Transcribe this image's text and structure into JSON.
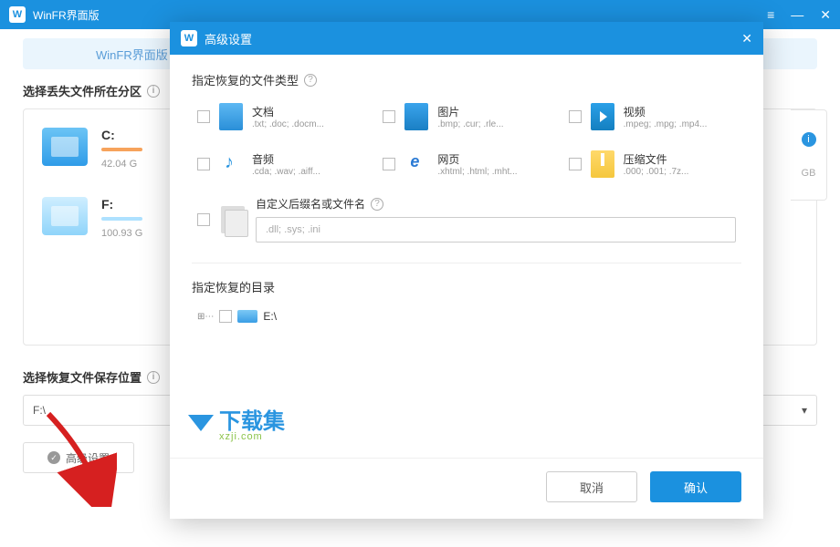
{
  "titlebar": {
    "app_name": "WinFR界面版"
  },
  "banner": {
    "text": "WinFR界面版"
  },
  "labels": {
    "select_partition": "选择丢失文件所在分区",
    "save_location": "选择恢复文件保存位置",
    "advanced_btn": "高级设置"
  },
  "drives": [
    {
      "letter": "C:",
      "size": "42.04 G"
    },
    {
      "letter": "F:",
      "size": "100.93 G"
    }
  ],
  "save_select": {
    "value": "F:\\",
    "caret": "▾"
  },
  "right_clip": {
    "gb": "GB"
  },
  "modal": {
    "title": "高级设置",
    "section_filetype": "指定恢复的文件类型",
    "section_dir": "指定恢复的目录",
    "filetypes": [
      {
        "name": "文档",
        "ext": ".txt; .doc; .docm..."
      },
      {
        "name": "图片",
        "ext": ".bmp; .cur; .rle..."
      },
      {
        "name": "视频",
        "ext": ".mpeg; .mpg; .mp4..."
      },
      {
        "name": "音频",
        "ext": ".cda; .wav; .aiff..."
      },
      {
        "name": "网页",
        "ext": ".xhtml; .html; .mht..."
      },
      {
        "name": "压缩文件",
        "ext": ".000; .001; .7z..."
      }
    ],
    "custom": {
      "label": "自定义后缀名或文件名",
      "placeholder": ".dll; .sys; .ini"
    },
    "tree": {
      "root": "E:\\"
    },
    "buttons": {
      "cancel": "取消",
      "ok": "确认"
    }
  },
  "watermark": {
    "brand": "下载集",
    "url": "xzji.com"
  }
}
